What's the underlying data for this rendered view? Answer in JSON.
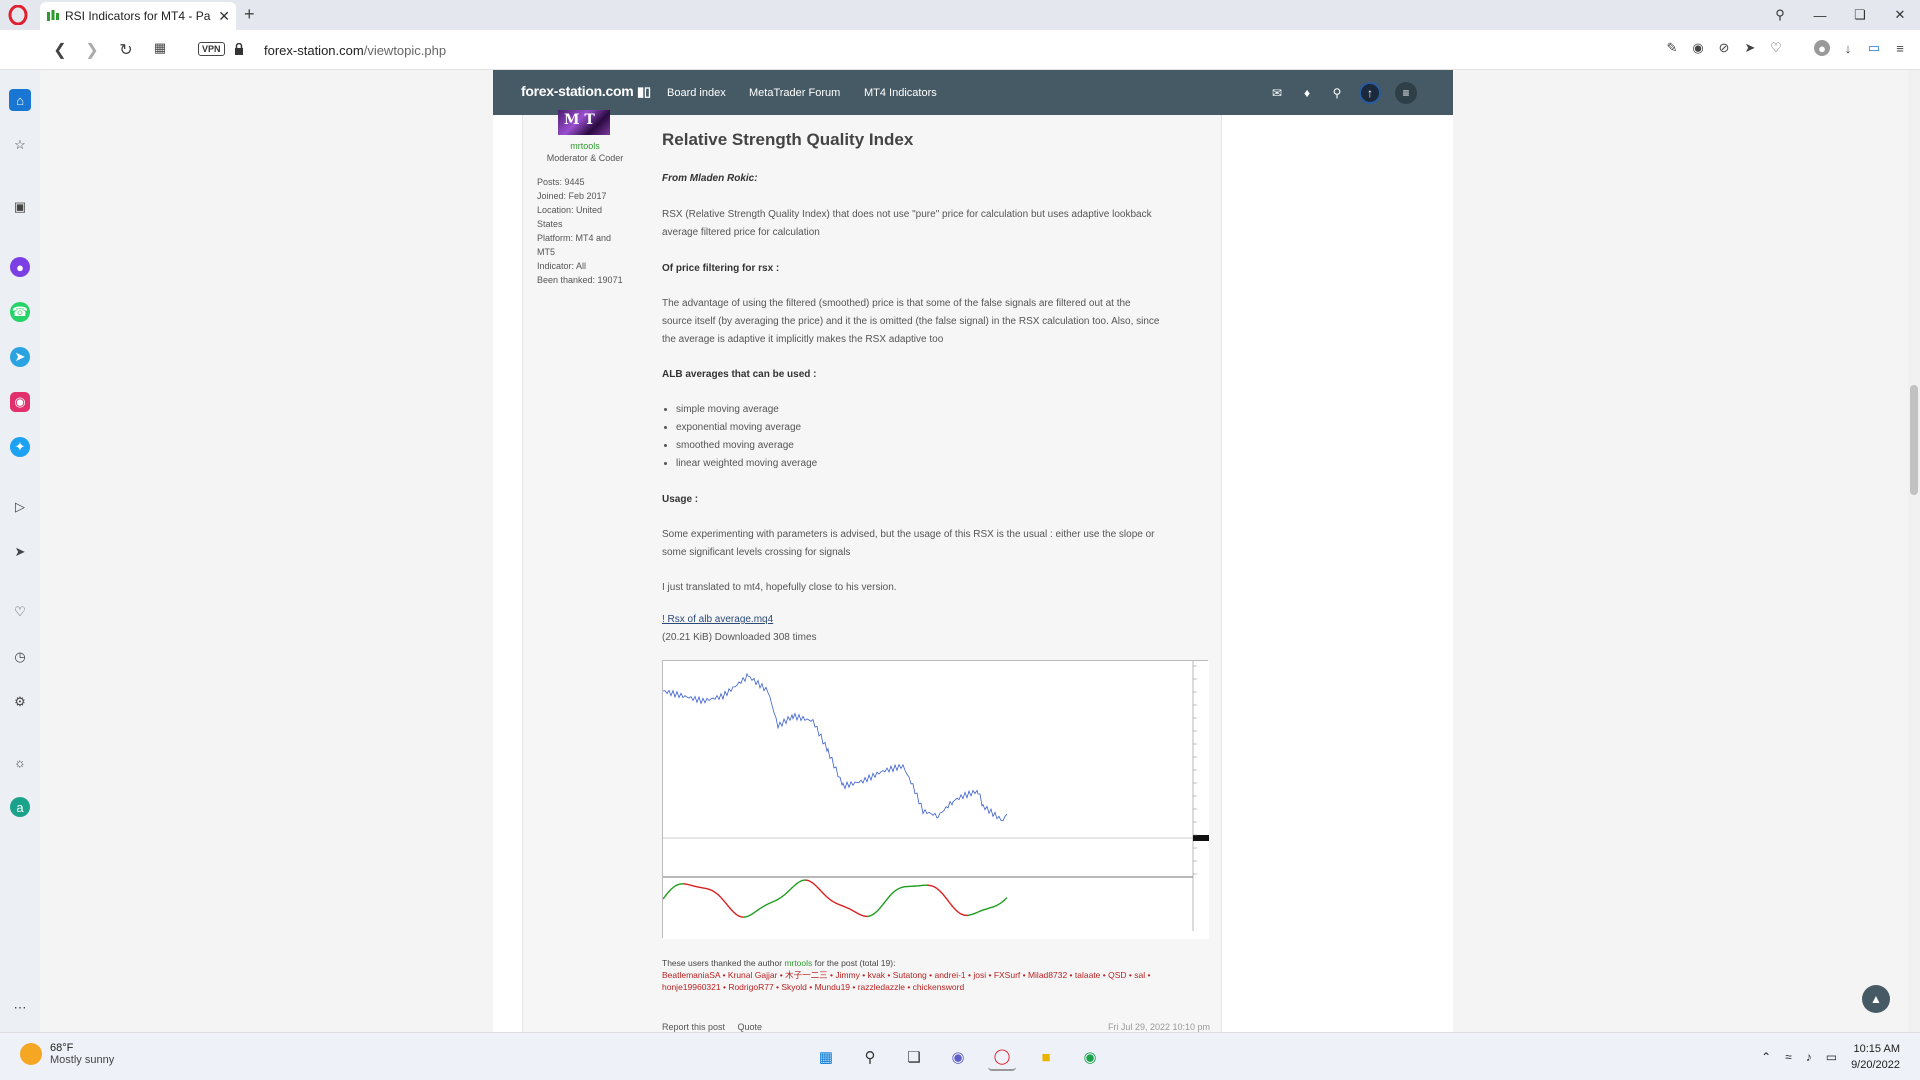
{
  "browser": {
    "tab_title": "RSI Indicators for MT4 - Pa",
    "url_domain": "forex-station.com",
    "url_path": "/viewtopic.php",
    "vpn_label": "VPN"
  },
  "forum_header": {
    "logo": "forex-station.com",
    "nav": [
      "Board index",
      "MetaTrader Forum",
      "MT4 Indicators"
    ]
  },
  "profile": {
    "username": "mrtools",
    "rank": "Moderator & Coder",
    "posts": "Posts: 9445",
    "joined": "Joined: Feb 2017",
    "location_1": "Location: United",
    "location_2": "States",
    "platform_1": "Platform: MT4 and",
    "platform_2": "MT5",
    "indicator": "Indicator: All",
    "thanked": "Been thanked: 19071"
  },
  "post": {
    "title": "Relative Strength Quality Index",
    "from": "From Mladen Rokic:",
    "p1_l1": "RSX (Relative Strength Quality Index) that does not use \"pure\" price for calculation but uses adaptive lookback",
    "p1_l2": "average filtered price for calculation",
    "h_filter": "Of price filtering for rsx :",
    "p2_l1": "The advantage of using the filtered (smoothed) price is that some of the false signals are filtered out at the",
    "p2_l2": "source itself (by averaging the price) and it the is omitted (the false signal) in the RSX calculation too. Also, since",
    "p2_l3": "the average is adaptive it implicitly makes the RSX adaptive too",
    "h_alb": "ALB averages that can be used :",
    "bullets": [
      "simple moving average",
      "exponential moving average",
      "smoothed moving average",
      "linear weighted moving average"
    ],
    "h_usage": "Usage :",
    "p3_l1": "Some experimenting with parameters is advised, but the usage of this RSX is the usual : either use the slope or",
    "p3_l2": "some significant levels crossing for signals",
    "p4": "I just translated to mt4, hopefully close to his version.",
    "attachment_name": "! Rsx of alb average.mq4",
    "attachment_info": "(20.21 KiB) Downloaded 308 times"
  },
  "thanks": {
    "intro": "These users thanked the author",
    "author": "mrtools",
    "suffix": "for the post (total 19):",
    "line1_users": "BeatlemaniaSA • Krunal Gajjar • 木子一二三 • Jimmy • kvak • Sutatong • andrei-1 • josi • FXSurf • Milad8732 • talaate • QSD • sal •",
    "line2_users": "honje19960321 • RodrigoR77 • Skyold • Mundu19 • razzledazzle • chickensword"
  },
  "post_footer": {
    "report": "Report this post",
    "quote": "Quote",
    "date": "Fri Jul 29, 2022 10:10 pm"
  },
  "taskbar": {
    "temp": "68°F",
    "weather": "Mostly sunny",
    "time": "10:15 AM",
    "date": "9/20/2022"
  },
  "colors": {
    "forum_header": "#465a66",
    "indicator_up": "#1a9a1a",
    "indicator_down": "#d81b1b",
    "price_up": "#3a5fcd",
    "price_down": "#c0392b"
  }
}
